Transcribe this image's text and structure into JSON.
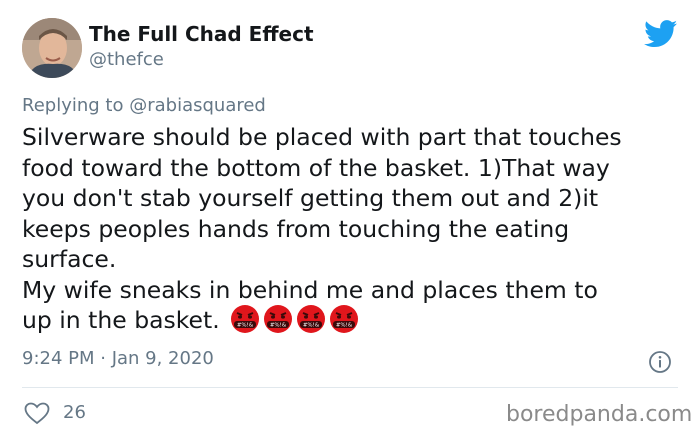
{
  "tweet": {
    "author": {
      "display_name": "The Full Chad Effect",
      "handle": "@thefce"
    },
    "reply": {
      "prefix": "Replying to",
      "mention": "@rabiasquared"
    },
    "text_lines": [
      "Silverware should be placed with part that touches",
      "food toward the bottom of the basket.  1)That way",
      "you don't stab yourself getting them out and 2)it",
      "keeps peoples hands from touching the eating",
      "surface.",
      "My wife sneaks in behind me and places them to",
      "up in the basket."
    ],
    "emoji_text": "#%!&",
    "timestamp": "9:24 PM · Jan 9, 2020",
    "likes": "26"
  },
  "icons": [
    "twitter-bird-icon",
    "info-icon",
    "heart-icon",
    "angry-face-symbols-emoji"
  ],
  "colors": {
    "twitter_blue": "#1da1f2",
    "secondary_text": "#657786",
    "emoji_red": "#e0161c",
    "divider": "#e1e8ed"
  },
  "watermark": "boredpanda.com"
}
